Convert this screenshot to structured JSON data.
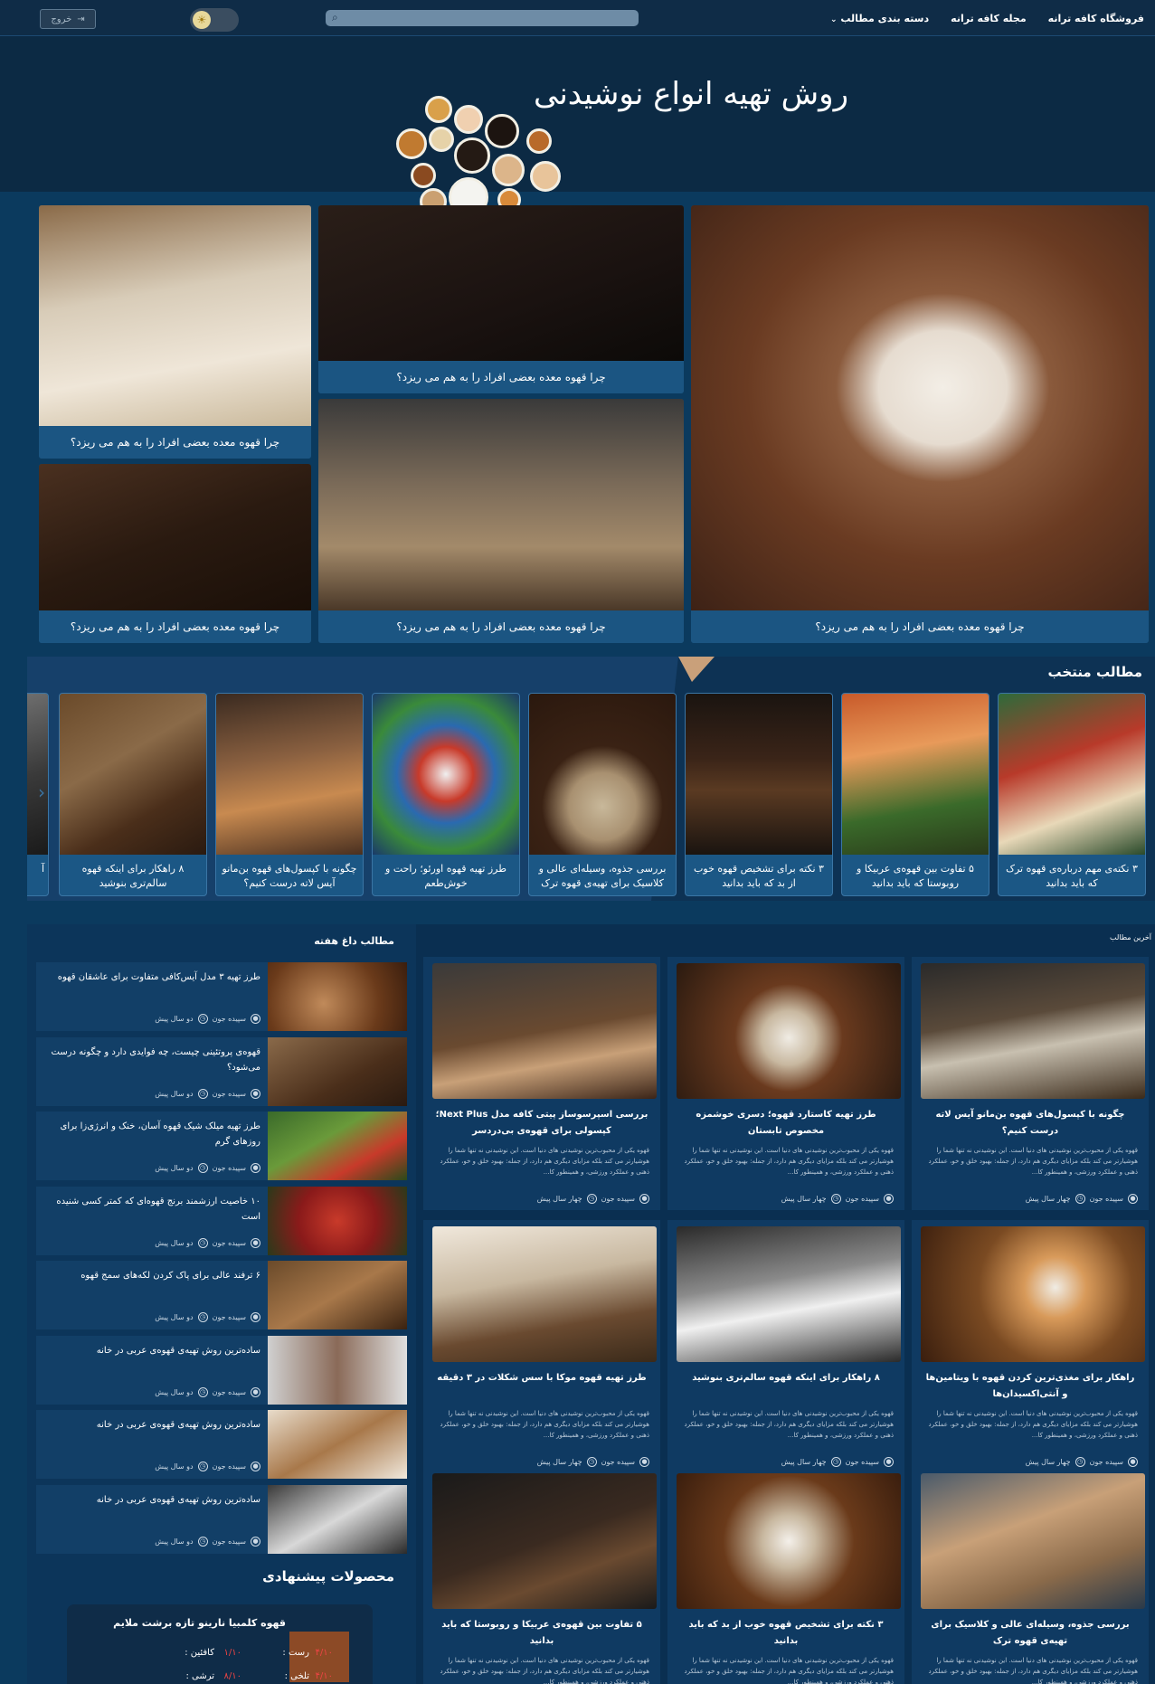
{
  "nav": {
    "items": [
      "فروشگاه کافه ترانه",
      "مجله کافه ترانه",
      "دسته بندی مطالب"
    ],
    "dropdown_icon": "chevron-down-icon",
    "search_icon": "search-icon",
    "theme_icon": "sun-icon",
    "logout_label": "خروج",
    "logout_icon": "logout-icon"
  },
  "hero": {
    "title": "روش تهیه انواع نوشیدنی"
  },
  "grid_tiles": [
    {
      "caption": "چرا قهوه معده بعضی افراد را به هم می ریزد؟"
    },
    {
      "caption": "چرا قهوه معده بعضی افراد را به هم می ریزد؟"
    },
    {
      "caption": "چرا قهوه معده بعضی افراد را به هم می ریزد؟"
    },
    {
      "caption": "چرا قهوه معده بعضی افراد را به هم می ریزد؟"
    },
    {
      "caption": "چرا قهوه معده بعضی افراد را به هم می ریزد؟"
    },
    {
      "caption": "چرا قهوه معده بعضی افراد را به هم می ریزد؟"
    }
  ],
  "featured": {
    "title": "مطالب منتخب",
    "items": [
      {
        "title": "۳ نکته‌ی مهم درباره‌ی قهوه ترک که باید بدانید"
      },
      {
        "title": "۵ تفاوت بین قهوه‌ی عربیکا و روبوستا که باید بدانید"
      },
      {
        "title": "۳ نکته برای تشخیص قهوه خوب از بد که باید بدانید"
      },
      {
        "title": "بررسی جذوه، وسیله‌ای عالی و کلاسیک برای تهیه‌ی قهوه ترک"
      },
      {
        "title": "طرز تهیه قهوه اورئو؛ راحت و خوش‌طعم"
      },
      {
        "title": "چگونه با کپسول‌های قهوه بن‌مانو آیس لاته درست کنیم؟"
      },
      {
        "title": "۸ راهکار برای اینکه قهوه سالم‌تری بنوشید"
      }
    ],
    "partial_label": "آ"
  },
  "weekly": {
    "title": "مطالب داغ هفته",
    "author_icon": "user-icon",
    "time_icon": "clock-icon",
    "items": [
      {
        "title": "طرز تهیه ۳ مدل آیس‌کافی متفاوت برای عاشقان قهوه",
        "author": "سپیده جون",
        "time": "دو سال پیش"
      },
      {
        "title": "قهوه‌ی پروتئینی چیست، چه فوایدی دارد و چگونه درست می‌شود؟",
        "author": "سپیده جون",
        "time": "دو سال پیش"
      },
      {
        "title": "طرز تهیه میلک شیک قهوه آسان، خنک و انرژی‌زا برای روزهای گرم",
        "author": "سپیده جون",
        "time": "دو سال پیش"
      },
      {
        "title": "۱۰ خاصیت ارزشمند برنج قهوه‌ای که کمتر کسی شنیده است",
        "author": "سپیده جون",
        "time": "دو سال پیش"
      },
      {
        "title": "۶ ترفند عالی برای پاک کردن لکه‌های سمج قهوه",
        "author": "سپیده جون",
        "time": "دو سال پیش"
      },
      {
        "title": "ساده‌ترین روش تهیه‌ی قهوه‌ی عربی در خانه",
        "author": "سپیده جون",
        "time": "دو سال پیش"
      },
      {
        "title": "ساده‌ترین روش تهیه‌ی قهوه‌ی عربی در خانه",
        "author": "سپیده جون",
        "time": "دو سال پیش"
      },
      {
        "title": "ساده‌ترین روش تهیه‌ی قهوه‌ی عربی در خانه",
        "author": "سپیده جون",
        "time": "دو سال پیش"
      }
    ]
  },
  "recommended": {
    "title": "محصولات پیشنهادی",
    "product": {
      "name": "قهوه کلمبیا نارینو تازه برشت ملایم",
      "caffeine_label": "کافئین :",
      "caffeine_value": "۱/۱۰",
      "body_label": "رست :",
      "body_value": "۴/۱۰",
      "row2_left": "۸/۱۰",
      "row2_right": "۴/۱۰",
      "row2_left_label": "ترشی :",
      "row2_right_label": "تلخی :"
    }
  },
  "latest": {
    "title": "آخرین مطالب",
    "desc": "قهوه یکی از محبوب‌ترین نوشیدنی های دنیا است. این نوشیدنی نه تنها شما را هوشیارتر می کند بلکه مزایای دیگری هم دارد، از جمله: بهبود خلق و خو، عملکرد ذهنی و عملکرد ورزشی، و همینطور کا...",
    "items": [
      {
        "title": "چگونه با کپسول‌های قهوه بن‌مانو آیس لاته درست کنیم؟",
        "author": "سپیده جون",
        "time": "چهار سال پیش"
      },
      {
        "title": "طرز تهیه کاستارد قهوه؛ دسری خوشمزه مخصوص تابستان",
        "author": "سپیده جون",
        "time": "چهار سال پیش"
      },
      {
        "title": "بررسی اسپرسوساز پیتی کافه مدل Next Plus؛ کپسولی برای قهوه‌ی بی‌دردسر",
        "author": "سپیده جون",
        "time": "چهار سال پیش"
      },
      {
        "title": "راهکار برای مغذی‌ترین کردن قهوه با ویتامین‌ها و آنتی‌اکسیدان‌ها",
        "author": "سپیده جون",
        "time": "چهار سال پیش"
      },
      {
        "title": "۸ راهکار برای اینکه قهوه سالم‌تری بنوشید",
        "author": "سپیده جون",
        "time": "چهار سال پیش"
      },
      {
        "title": "طرز تهیه قهوه موکا با سس شکلات در ۳ دقیقه",
        "author": "سپیده جون",
        "time": "چهار سال پیش"
      },
      {
        "title": "بررسی جذوه، وسیله‌ای عالی و کلاسیک برای تهیه‌ی قهوه ترک",
        "author": "",
        "time": ""
      },
      {
        "title": "۳ نکته برای تشخیص قهوه خوب از بد که باید بدانید",
        "author": "",
        "time": ""
      },
      {
        "title": "۵ تفاوت بین قهوه‌ی عربیکا و روبوستا که باید بدانید",
        "author": "",
        "time": ""
      }
    ]
  }
}
